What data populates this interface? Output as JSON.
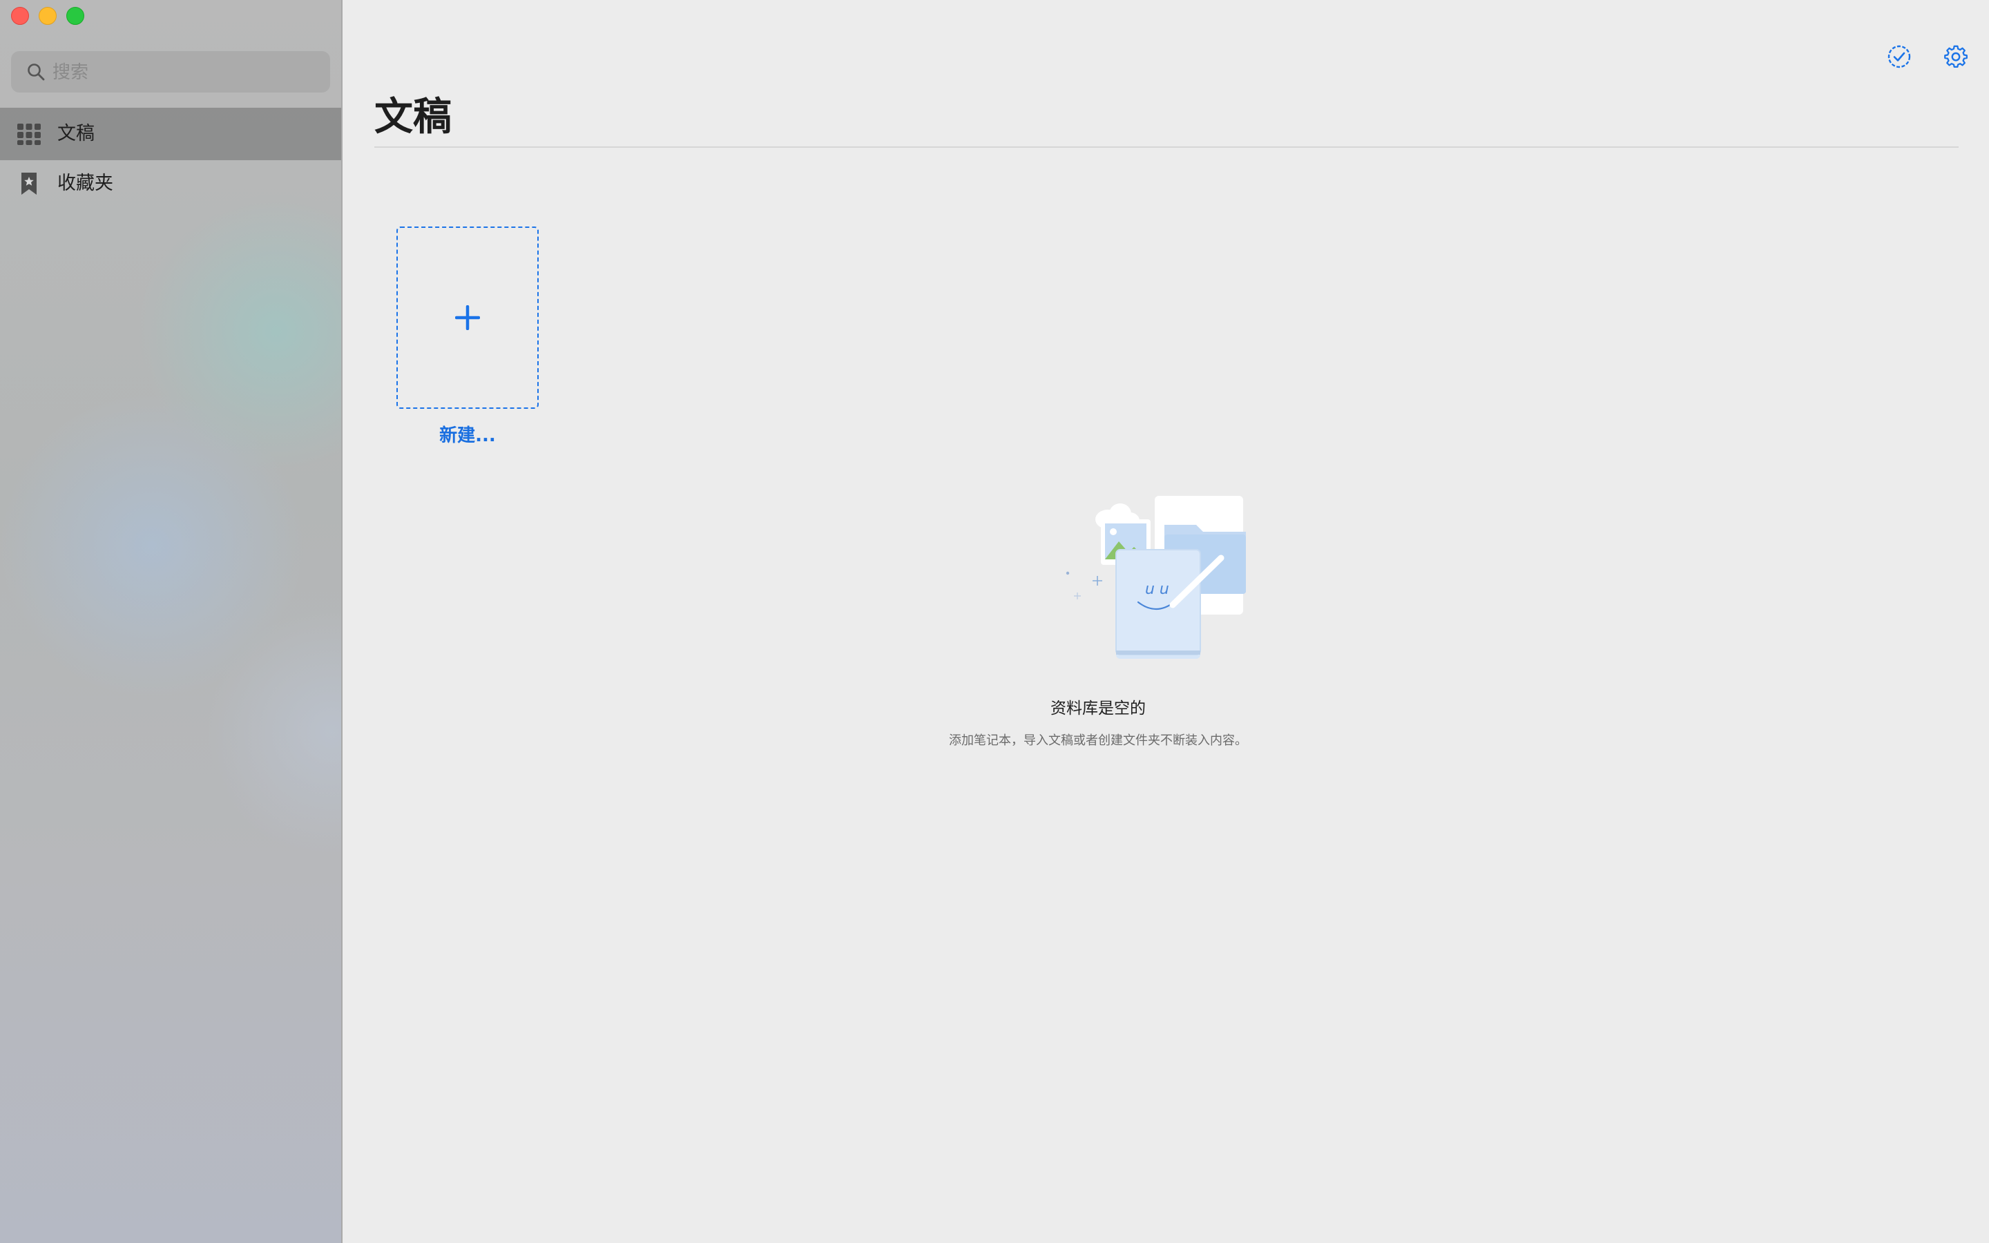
{
  "window": {
    "controls": [
      "close",
      "minimize",
      "zoom"
    ]
  },
  "sidebar": {
    "search": {
      "placeholder": "搜索",
      "value": ""
    },
    "items": [
      {
        "label": "文稿",
        "icon": "grid-icon",
        "selected": true
      },
      {
        "label": "收藏夹",
        "icon": "bookmark-star-icon",
        "selected": false
      }
    ]
  },
  "header": {
    "title": "文稿",
    "actions": [
      {
        "icon": "select-check-icon"
      },
      {
        "icon": "gear-icon"
      }
    ]
  },
  "main": {
    "new_card": {
      "label": "新建..."
    },
    "empty_state": {
      "title": "资料库是空的",
      "description": "添加笔记本，导入文稿或者创建文件夹不断装入内容。"
    }
  },
  "colors": {
    "accent": "#1a73e8",
    "close": "#ff5f57",
    "minimize": "#febc2e",
    "zoom": "#28c840"
  }
}
